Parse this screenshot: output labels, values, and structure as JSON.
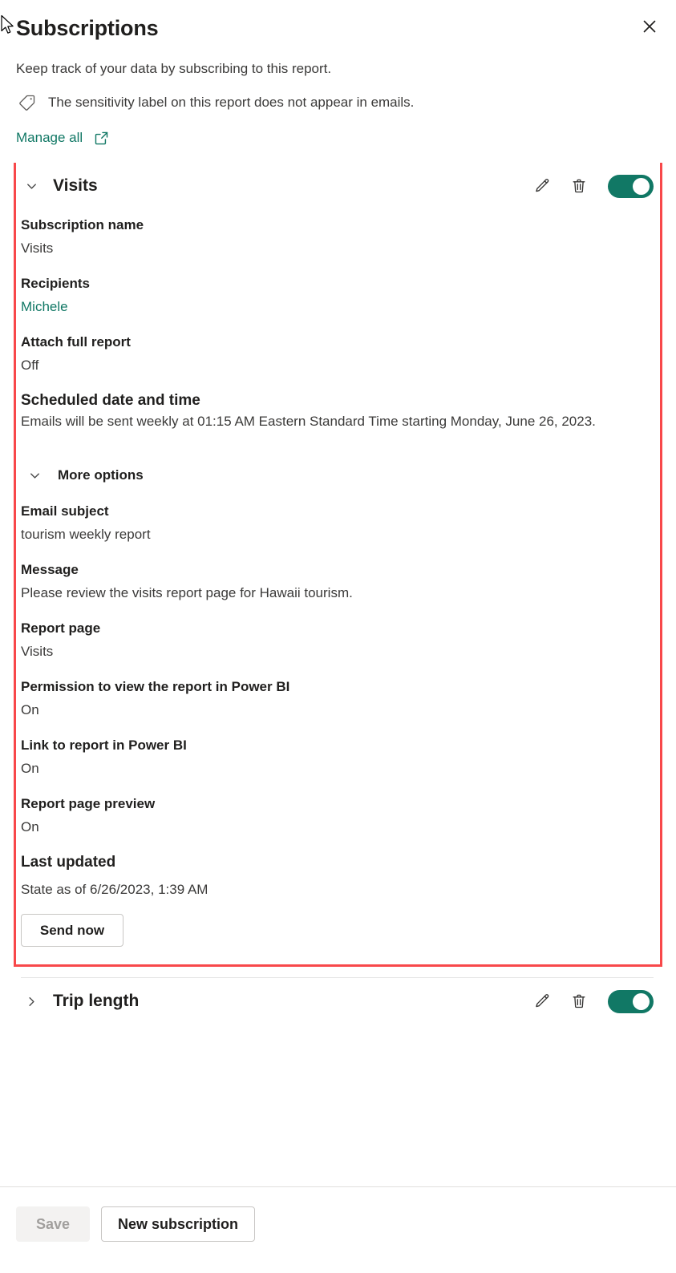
{
  "header": {
    "title": "Subscriptions",
    "close_label": "✕",
    "subtitle": "Keep track of your data by subscribing to this report.",
    "sensitivity_note": "The sensitivity label on this report does not appear in emails.",
    "sensitivity_icon": "tag-icon",
    "manage_all_label": "Manage all",
    "manage_all_icon": "external-link-icon"
  },
  "colors": {
    "accent_teal": "#117865",
    "highlight_red": "#f8484a",
    "text_primary": "#201f1e",
    "text_secondary": "#3b3a39"
  },
  "subscriptions": [
    {
      "name": "Visits",
      "expanded": true,
      "chevron_icon": "chevron-down-icon",
      "edit_icon": "pencil-icon",
      "delete_icon": "trash-icon",
      "toggle_state": "on",
      "highlighted": true,
      "fields": {
        "subscription_name_label": "Subscription name",
        "subscription_name_value": "Visits",
        "recipients_label": "Recipients",
        "recipients_value": "Michele",
        "attach_full_report_label": "Attach full report",
        "attach_full_report_value": "Off",
        "scheduled_label": "Scheduled date and time",
        "scheduled_value": "Emails will be sent weekly at 01:15 AM Eastern Standard Time starting Monday, June 26, 2023.",
        "more_options_label": "More options",
        "more_options_icon": "chevron-down-icon",
        "email_subject_label": "Email subject",
        "email_subject_value": "tourism weekly report",
        "message_label": "Message",
        "message_value": "Please review the visits report page for Hawaii tourism.",
        "report_page_label": "Report page",
        "report_page_value": "Visits",
        "permission_label": "Permission to view the report in Power BI",
        "permission_value": "On",
        "link_label": "Link to report in Power BI",
        "link_value": "On",
        "preview_label": "Report page preview",
        "preview_value": "On",
        "last_updated_label": "Last updated",
        "last_updated_value": "State as of 6/26/2023, 1:39 AM",
        "send_now_label": "Send now"
      }
    },
    {
      "name": "Trip length",
      "expanded": false,
      "chevron_icon": "chevron-right-icon",
      "edit_icon": "pencil-icon",
      "delete_icon": "trash-icon",
      "toggle_state": "on",
      "highlighted": false
    }
  ],
  "footer": {
    "save_label": "Save",
    "save_disabled": true,
    "new_subscription_label": "New subscription"
  }
}
